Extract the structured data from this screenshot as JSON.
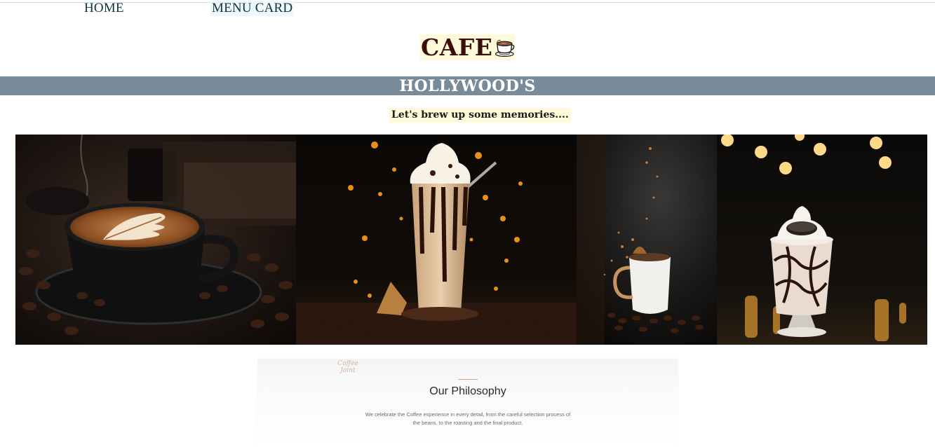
{
  "nav": {
    "home_label": "HOME",
    "menu_label": "MENU CARD"
  },
  "logo": {
    "text": "CAFE",
    "icon": "coffee-cup-icon"
  },
  "banner": {
    "title": "HOLLYWOOD'S"
  },
  "tagline": "Let's brew up some memories....",
  "gallery": {
    "images": [
      {
        "subject": "latte-art-cup"
      },
      {
        "subject": "chocolate-frappe-glass"
      },
      {
        "subject": "coffee-mug-beans"
      },
      {
        "subject": "oreo-milkshake"
      }
    ]
  },
  "philosophy": {
    "logo_text": "Coffee Joint",
    "title": "Our Philosophy",
    "body": "We celebrate the Coffee experience in every detail, from the careful selection process of the beans, to the roasting and the final product."
  },
  "colors": {
    "banner_bg": "#798a98",
    "logo_bg": "#fdf9d9",
    "logo_text": "#3b0e0e",
    "nav_text": "#0d3640"
  }
}
